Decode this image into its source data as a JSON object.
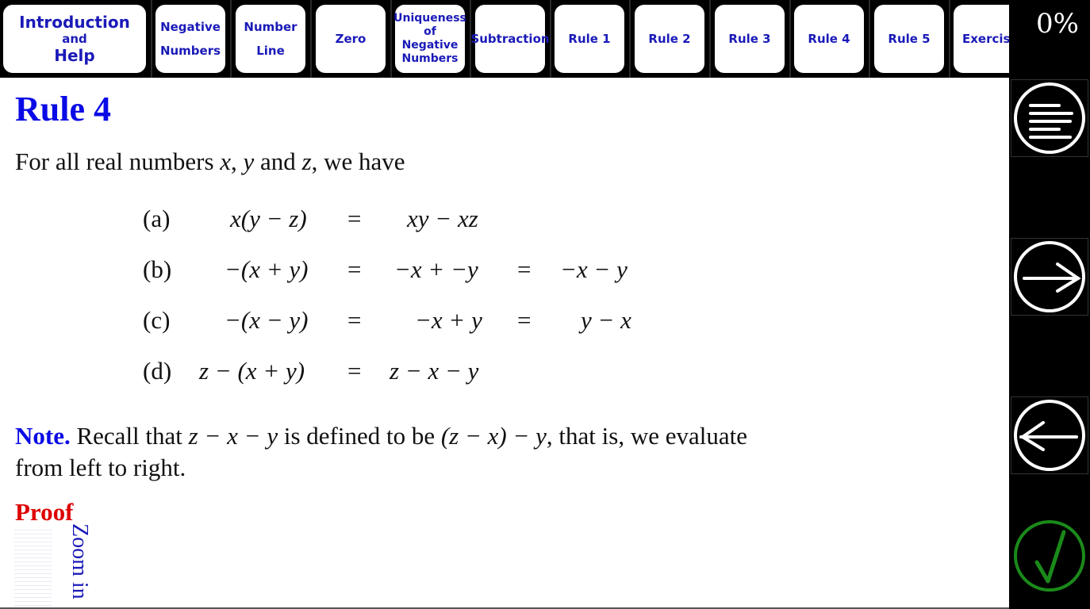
{
  "nav": {
    "tabs": [
      {
        "lines": [
          "Introduction",
          "and",
          "Help"
        ]
      },
      {
        "lines": [
          "Negative",
          "Numbers"
        ]
      },
      {
        "lines": [
          "Number",
          "Line"
        ]
      },
      {
        "lines": [
          "Zero"
        ]
      },
      {
        "lines": [
          "Uniqueness",
          "of",
          "Negative",
          "Numbers"
        ]
      },
      {
        "lines": [
          "Subtraction"
        ]
      },
      {
        "lines": [
          "Rule 1"
        ]
      },
      {
        "lines": [
          "Rule 2"
        ]
      },
      {
        "lines": [
          "Rule 3"
        ]
      },
      {
        "lines": [
          "Rule 4"
        ]
      },
      {
        "lines": [
          "Rule 5"
        ]
      },
      {
        "lines": [
          "Exercise"
        ]
      }
    ]
  },
  "sidebar": {
    "progress": "0%",
    "buttons": [
      "menu-icon",
      "arrow-right-icon",
      "arrow-left-icon",
      "check-icon"
    ],
    "accent_check": "#1a8a1a"
  },
  "page": {
    "title": "Rule 4",
    "intro_pre": "For all real numbers ",
    "intro_x": "x",
    "intro_comma1": ", ",
    "intro_y": "y",
    "intro_and": " and ",
    "intro_z": "z",
    "intro_post": ", we have",
    "equations": [
      {
        "label": "(a)",
        "lhs": "x(y − z)",
        "eq1": "=",
        "mid": "xy − xz",
        "eq2": "",
        "rhs": ""
      },
      {
        "label": "(b)",
        "lhs": "−(x + y)",
        "eq1": "=",
        "mid": "−x + −y",
        "eq2": "=",
        "rhs": "−x − y"
      },
      {
        "label": "(c)",
        "lhs": "−(x − y)",
        "eq1": "=",
        "mid": "−x + y",
        "eq2": "=",
        "rhs": "y − x"
      },
      {
        "label": "(d)",
        "lhs": "z − (x + y)",
        "eq1": "=",
        "mid": "z − x − y",
        "eq2": "",
        "rhs": ""
      }
    ],
    "note_label": "Note.",
    "note_text_1": " Recall that ",
    "note_math_1": "z − x − y",
    "note_text_2": " is defined to be ",
    "note_math_2": "(z − x) − y",
    "note_text_3": ", that is, we evaluate from left to right.",
    "proof_label": "Proof",
    "zoom_label": "Zoom in"
  },
  "colors": {
    "heading": "#0a0ae6",
    "tab_text": "#1a1ab8",
    "proof": "#dd0000"
  }
}
